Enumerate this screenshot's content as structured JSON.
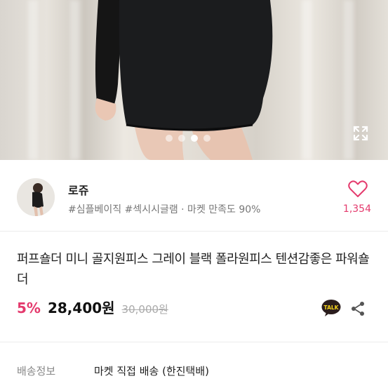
{
  "gallery": {
    "expand_icon": "expand-icon",
    "page_indicators": [
      {
        "active": false
      },
      {
        "active": false
      },
      {
        "active": true
      },
      {
        "active": false
      }
    ]
  },
  "seller": {
    "name": "로쥬",
    "tags": "#심플베이직 #섹시시글램 · 마켓 만족도 90%",
    "likes": "1,354",
    "heart_icon": "heart-icon",
    "accent_color": "#e43a6d"
  },
  "product": {
    "title": "퍼프숄더 미니 골지원피스 그레이 블랙 폴라원피스 텐션감좋은 파워숄더",
    "discount": "5%",
    "price": "28,400원",
    "original_price": "30,000원",
    "talk_label": "TALK",
    "share_icon": "share-icon"
  },
  "shipping": {
    "label": "배송정보",
    "value": "마켓 직접 배송 (한진택배)"
  }
}
